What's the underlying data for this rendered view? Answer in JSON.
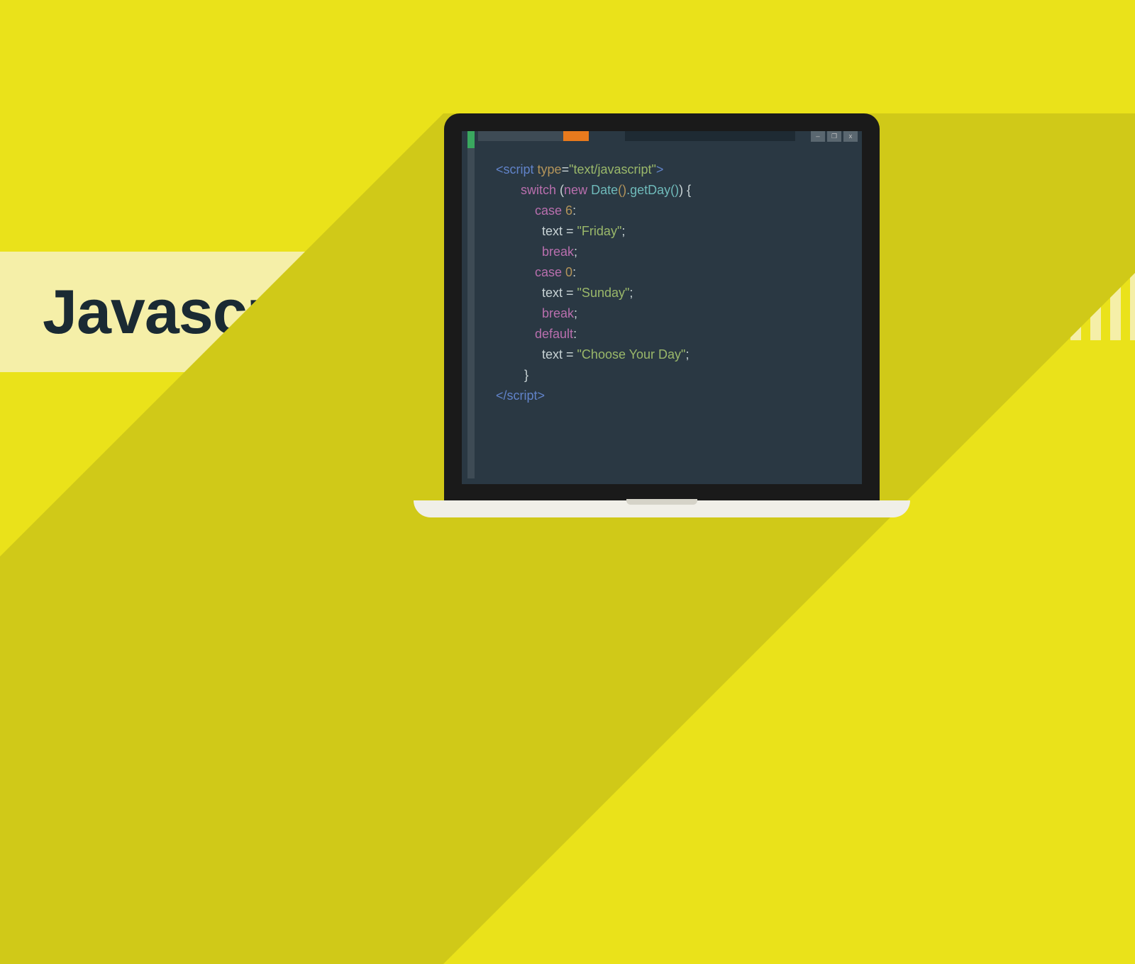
{
  "title": "Javascript",
  "window_buttons": {
    "minimize": "—",
    "maximize": "❐",
    "close": "x"
  },
  "code_tokens": {
    "lt": "<",
    "gt": ">",
    "ltsl": "</",
    "script": "script",
    "type_attr": " type",
    "eq": "=",
    "type_val": "\"text/javascript\"",
    "switch": "switch",
    "sp": " ",
    "paren_open": "(",
    "new": "new",
    "date": " Date",
    "date_call": "()",
    "getday": ".getDay()",
    "paren_close": ")",
    "brace_open": " {",
    "brace_close": "}",
    "case": "case",
    "six": " 6",
    "zero": " 0",
    "colon": ":",
    "textvar": "text ",
    "eq_sp": "= ",
    "friday": "\"Friday\"",
    "sunday": "\"Sunday\"",
    "choose": "\"Choose Your Day\"",
    "semi": ";",
    "break": "break",
    "default": "default",
    "ind1": "       ",
    "ind2": "           ",
    "ind3": "             ",
    "ind_close": "        "
  }
}
